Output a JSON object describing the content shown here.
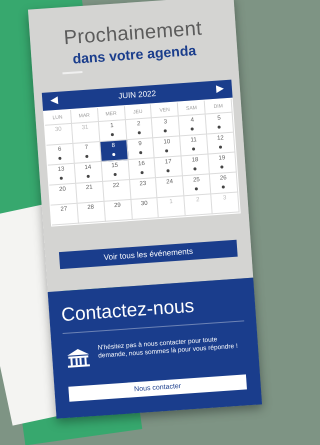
{
  "header": {
    "title_line1": "Prochainement",
    "title_line2": "dans votre agenda"
  },
  "calendar": {
    "month_label": "JUIN 2022",
    "weekdays": [
      "LUN",
      "MAR",
      "MER",
      "JEU",
      "VEN",
      "SAM",
      "DIM"
    ],
    "weeks": [
      [
        {
          "d": "30",
          "muted": true,
          "dot": false
        },
        {
          "d": "31",
          "muted": true,
          "dot": false
        },
        {
          "d": "1",
          "dot": true
        },
        {
          "d": "2",
          "dot": true
        },
        {
          "d": "3",
          "dot": true
        },
        {
          "d": "4",
          "dot": true
        },
        {
          "d": "5",
          "dot": true
        }
      ],
      [
        {
          "d": "6",
          "dot": true
        },
        {
          "d": "7",
          "dot": true
        },
        {
          "d": "8",
          "dot": true,
          "selected": true
        },
        {
          "d": "9",
          "dot": true
        },
        {
          "d": "10",
          "dot": true
        },
        {
          "d": "11",
          "dot": true
        },
        {
          "d": "12",
          "dot": true
        }
      ],
      [
        {
          "d": "13",
          "dot": true
        },
        {
          "d": "14",
          "dot": true
        },
        {
          "d": "15",
          "dot": true
        },
        {
          "d": "16",
          "dot": true
        },
        {
          "d": "17",
          "dot": true
        },
        {
          "d": "18",
          "dot": true
        },
        {
          "d": "19",
          "dot": true
        }
      ],
      [
        {
          "d": "20",
          "dot": false
        },
        {
          "d": "21",
          "dot": false
        },
        {
          "d": "22",
          "dot": false
        },
        {
          "d": "23",
          "dot": false
        },
        {
          "d": "24",
          "dot": false
        },
        {
          "d": "25",
          "dot": true
        },
        {
          "d": "26",
          "dot": true
        }
      ],
      [
        {
          "d": "27",
          "dot": false
        },
        {
          "d": "28",
          "dot": false
        },
        {
          "d": "29",
          "dot": false
        },
        {
          "d": "30",
          "dot": false
        },
        {
          "d": "1",
          "muted": true,
          "dot": false
        },
        {
          "d": "2",
          "muted": true,
          "dot": false
        },
        {
          "d": "3",
          "muted": true,
          "dot": false
        }
      ]
    ],
    "view_all_label": "Voir tous les événements"
  },
  "contact": {
    "title": "Contactez-nous",
    "text": "N'hésitez pas à nous contacter pour toute demande, nous sommes là pour vous répondre !",
    "button_label": "Nous contacter",
    "icon": "bank-building-icon"
  },
  "colors": {
    "primary": "#1a3d8c",
    "panel_bg": "#d4d4d2",
    "green": "#37a86e"
  }
}
